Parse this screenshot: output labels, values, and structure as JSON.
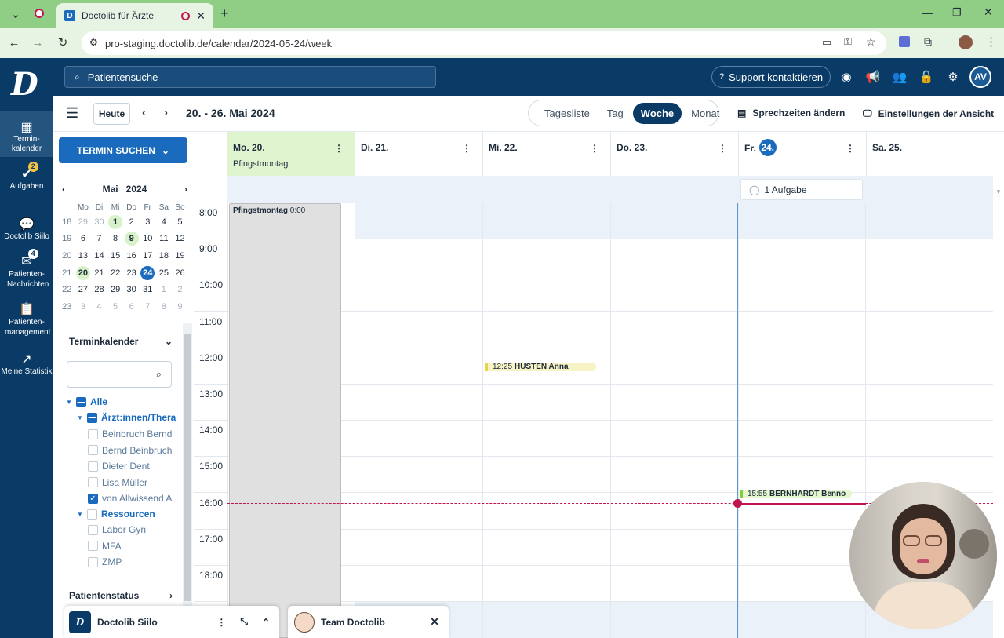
{
  "browser": {
    "tab_title": "Doctolib für Ärzte",
    "url": "pro-staging.doctolib.de/calendar/2024-05-24/week",
    "new_tab": "+"
  },
  "header": {
    "search_placeholder": "Patientensuche",
    "support": "Support kontaktieren",
    "avatar": "AV"
  },
  "nav": {
    "logo": "D",
    "items": [
      {
        "label": "Termin-kalender"
      },
      {
        "label": "Aufgaben",
        "badge": "2"
      },
      {
        "label": "Doctolib Siilo"
      },
      {
        "label": "Patienten-Nachrichten",
        "badge": "4"
      },
      {
        "label": "Patienten-management"
      },
      {
        "label": "Meine Statistik"
      }
    ]
  },
  "toolbar": {
    "today": "Heute",
    "date_range": "20. - 26. Mai 2024",
    "views": [
      "Tagesliste",
      "Tag",
      "Woche",
      "Monat"
    ],
    "active_view": "Woche",
    "sprechzeiten": "Sprechzeiten ändern",
    "einstellungen": "Einstellungen der Ansicht"
  },
  "sidebar": {
    "termin_suchen": "TERMIN SUCHEN",
    "minical": {
      "month": "Mai",
      "year": "2024",
      "weekdays": [
        "Mo",
        "Di",
        "Mi",
        "Do",
        "Fr",
        "Sa",
        "So"
      ],
      "weeks": [
        {
          "wk": "18",
          "days": [
            "29",
            "30",
            "1",
            "2",
            "3",
            "4",
            "5"
          ]
        },
        {
          "wk": "19",
          "days": [
            "6",
            "7",
            "8",
            "9",
            "10",
            "11",
            "12"
          ]
        },
        {
          "wk": "20",
          "days": [
            "13",
            "14",
            "15",
            "16",
            "17",
            "18",
            "19"
          ]
        },
        {
          "wk": "21",
          "days": [
            "20",
            "21",
            "22",
            "23",
            "24",
            "25",
            "26"
          ]
        },
        {
          "wk": "22",
          "days": [
            "27",
            "28",
            "29",
            "30",
            "31",
            "1",
            "2"
          ]
        },
        {
          "wk": "23",
          "days": [
            "3",
            "4",
            "5",
            "6",
            "7",
            "8",
            "9"
          ]
        }
      ]
    },
    "terminkalender": "Terminkalender",
    "tree": {
      "alle": "Alle",
      "aerzte": "Ärzt:innen/Thera",
      "doctors": [
        "Beinbruch Bernd",
        "Bernd Beinbruch",
        "Dieter Dent",
        "Lisa Müller",
        "von Allwissend A"
      ],
      "ressourcen": "Ressourcen",
      "resources": [
        "Labor Gyn",
        "MFA",
        "ZMP"
      ]
    },
    "patientenstatus": "Patientenstatus"
  },
  "calendar": {
    "days": [
      {
        "label": "Mo. 20.",
        "sub": "Pfingstmontag"
      },
      {
        "label": "Di. 21.",
        "sub": ""
      },
      {
        "label": "Mi. 22.",
        "sub": ""
      },
      {
        "label": "Do. 23.",
        "sub": ""
      },
      {
        "label": "Fr.",
        "num": "24.",
        "sub": ""
      },
      {
        "label": "Sa. 25.",
        "sub": ""
      }
    ],
    "task": "1 Aufgabe",
    "hours": [
      "8:00",
      "9:00",
      "10:00",
      "11:00",
      "12:00",
      "13:00",
      "14:00",
      "15:00",
      "16:00",
      "17:00",
      "18:00"
    ],
    "holiday_title": "Pfingstmontag",
    "holiday_time": "0:00",
    "appointments": [
      {
        "time": "12:25",
        "name": "HUSTEN Anna",
        "color": "#f2e36b"
      },
      {
        "time": "15:55",
        "name": "BERNHARDT Benno",
        "color": "#c8ec8e"
      }
    ]
  },
  "bottom": {
    "siilo": "Doctolib Siilo",
    "team": "Team Doctolib"
  },
  "colors": {
    "brand": "#0a3a66",
    "accent": "#1a6bbd",
    "now": "#c0134f"
  }
}
